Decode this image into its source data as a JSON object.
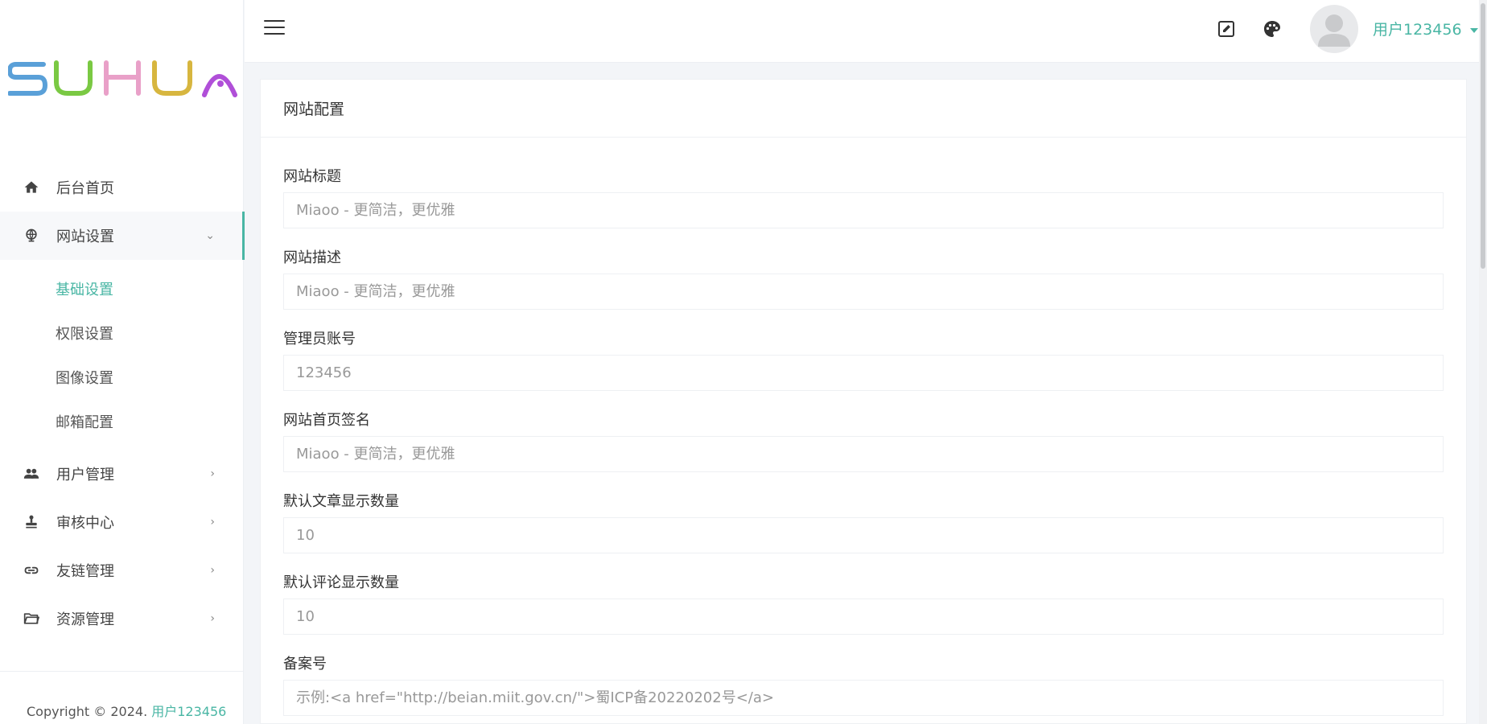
{
  "brand": {
    "logo_text": "SUHUA",
    "colors": {
      "s": "#5aa0d8",
      "u1": "#7ac943",
      "h": "#e9a0c8",
      "u2": "#d7b63f",
      "a": "#b04fd8"
    }
  },
  "accent": "#49b6a4",
  "sidebar": {
    "items": [
      {
        "label": "后台首页",
        "icon": "home-icon"
      },
      {
        "label": "网站设置",
        "icon": "globe-icon",
        "arrow": "⌄",
        "children": [
          {
            "label": "基础设置",
            "active": true
          },
          {
            "label": "权限设置"
          },
          {
            "label": "图像设置"
          },
          {
            "label": "邮箱配置"
          }
        ]
      },
      {
        "label": "用户管理",
        "icon": "people-icon",
        "arrow": "›"
      },
      {
        "label": "审核中心",
        "icon": "stamp-icon",
        "arrow": "›"
      },
      {
        "label": "友链管理",
        "icon": "link-icon",
        "arrow": "›"
      },
      {
        "label": "资源管理",
        "icon": "folder-icon",
        "arrow": "›"
      }
    ],
    "footer": {
      "copyright": "Copyright © 2024. ",
      "user": "用户123456"
    }
  },
  "topbar": {
    "username": "用户123456"
  },
  "card": {
    "title": "网站配置",
    "fields": [
      {
        "label": "网站标题",
        "placeholder": "Miaoo - 更简洁，更优雅"
      },
      {
        "label": "网站描述",
        "placeholder": "Miaoo - 更简洁，更优雅"
      },
      {
        "label": "管理员账号",
        "placeholder": "123456"
      },
      {
        "label": "网站首页签名",
        "placeholder": "Miaoo - 更简洁，更优雅"
      },
      {
        "label": "默认文章显示数量",
        "placeholder": "10"
      },
      {
        "label": "默认评论显示数量",
        "placeholder": "10"
      },
      {
        "label": "备案号",
        "placeholder": "示例:<a href=\"http://beian.miit.gov.cn/\">蜀ICP备20220202号</a>"
      }
    ]
  }
}
